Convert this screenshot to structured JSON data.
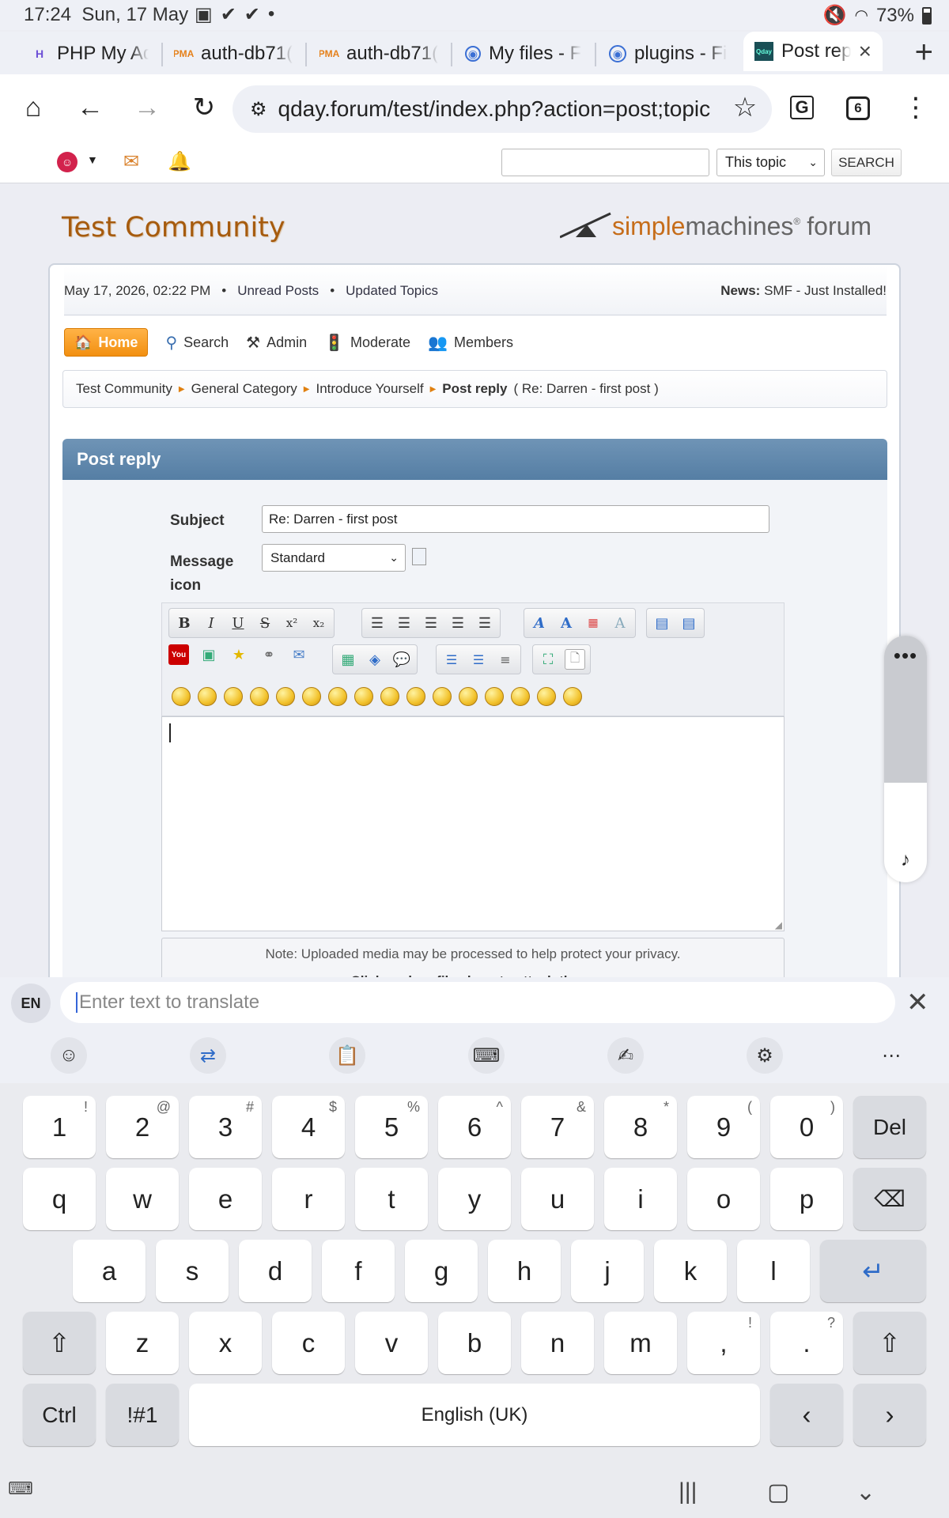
{
  "status": {
    "time": "17:24",
    "date": "Sun, 17 May",
    "battery": "73%"
  },
  "browser": {
    "tabs": [
      {
        "title": "PHP My Ad",
        "active": false
      },
      {
        "title": "auth-db71(",
        "active": false
      },
      {
        "title": "auth-db71(",
        "active": false
      },
      {
        "title": "My files - F",
        "active": false
      },
      {
        "title": "plugins - Fi",
        "active": false
      },
      {
        "title": "Post rep",
        "active": true
      }
    ],
    "url": "qday.forum/test/index.php?action=post;topic",
    "tab_count": "6"
  },
  "topbar": {
    "search_scope": "This topic",
    "search_button": "SEARCH"
  },
  "forum": {
    "title": "Test Community",
    "logo_part1": "simple",
    "logo_part2": "machines",
    "logo_part3": "forum",
    "datetime": "May 17, 2026, 02:22 PM",
    "unread": "Unread Posts",
    "updated": "Updated Topics",
    "news_label": "News:",
    "news_text": "SMF - Just Installed!",
    "menu": {
      "home": "Home",
      "search": "Search",
      "admin": "Admin",
      "moderate": "Moderate",
      "members": "Members"
    },
    "breadcrumb": {
      "c1": "Test Community",
      "c2": "General Category",
      "c3": "Introduce Yourself",
      "c4": "Post reply",
      "c4_detail": "( Re: Darren - first post )"
    },
    "panel_title": "Post reply",
    "subject_label": "Subject",
    "subject_value": "Re: Darren - first post",
    "icon_label": "Message icon",
    "icon_value": "Standard",
    "attach_note": "Note: Uploaded media may be processed to help protect your privacy.",
    "attach_drop": "Click or drag files here to attach them."
  },
  "translate": {
    "lang": "EN",
    "placeholder": "Enter text to translate"
  },
  "keyboard": {
    "row1": [
      "1",
      "2",
      "3",
      "4",
      "5",
      "6",
      "7",
      "8",
      "9",
      "0"
    ],
    "row1_sup": [
      "!",
      "@",
      "#",
      "$",
      "%",
      "^",
      "&",
      "*",
      "(",
      ")"
    ],
    "row2": [
      "q",
      "w",
      "e",
      "r",
      "t",
      "y",
      "u",
      "i",
      "o",
      "p"
    ],
    "row3": [
      "a",
      "s",
      "d",
      "f",
      "g",
      "h",
      "j",
      "k",
      "l"
    ],
    "row4": [
      "z",
      "x",
      "c",
      "v",
      "b",
      "n",
      "m"
    ],
    "del": "Del",
    "ctrl": "Ctrl",
    "symbols": "!#1",
    "space": "English (UK)"
  }
}
